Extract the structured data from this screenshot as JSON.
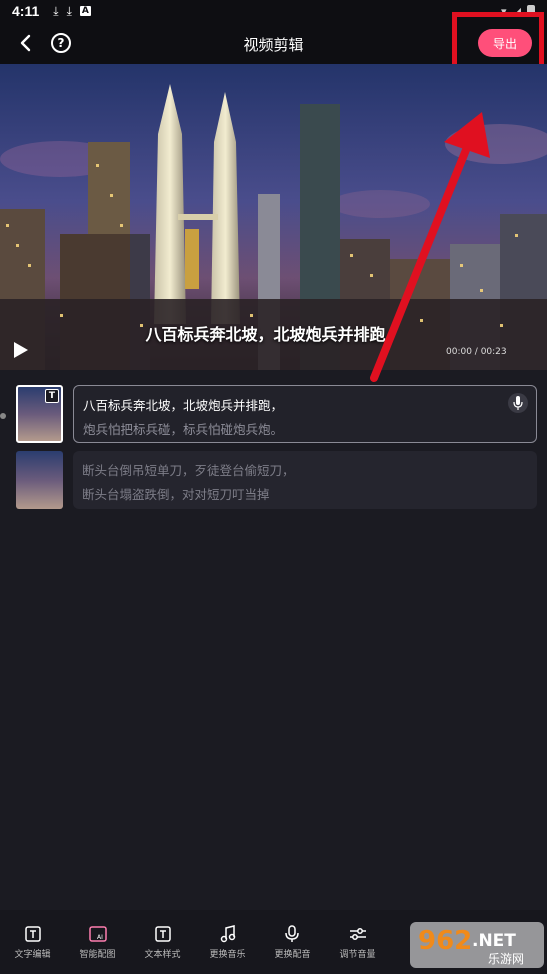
{
  "status": {
    "time": "4:11",
    "icons": [
      "download-icon",
      "download-icon",
      "a-icon"
    ]
  },
  "header": {
    "title": "视频剪辑",
    "export_label": "导出"
  },
  "video": {
    "subtitle": "八百标兵奔北坡，北坡炮兵并排跑，",
    "time": "00:00 / 00:23"
  },
  "clips": [
    {
      "line1": "八百标兵奔北坡，北坡炮兵并排跑，",
      "line2": "炮兵怕把标兵碰，标兵怕碰炮兵炮。",
      "active": true,
      "badge": "T"
    },
    {
      "line1": "断头台倒吊短单刀，歹徒登台偷短刀，",
      "line2": "断头台塌盗跌倒，对对短刀叮当掉",
      "active": false
    }
  ],
  "toolbar": [
    {
      "label": "文字编辑",
      "icon": "text-edit-icon"
    },
    {
      "label": "智能配图",
      "icon": "ai-image-icon"
    },
    {
      "label": "文本样式",
      "icon": "text-style-icon"
    },
    {
      "label": "更换音乐",
      "icon": "music-icon"
    },
    {
      "label": "更换配音",
      "icon": "voice-icon"
    },
    {
      "label": "调节音量",
      "icon": "volume-adjust-icon"
    },
    {
      "label": "",
      "icon": "speed-icon"
    },
    {
      "label": "",
      "icon": "more-icon"
    }
  ],
  "watermark": {
    "brand": "962",
    "suffix": ".NET",
    "sub": "乐游网"
  },
  "colors": {
    "accent": "#ff4f7a",
    "highlight": "#e01020"
  }
}
